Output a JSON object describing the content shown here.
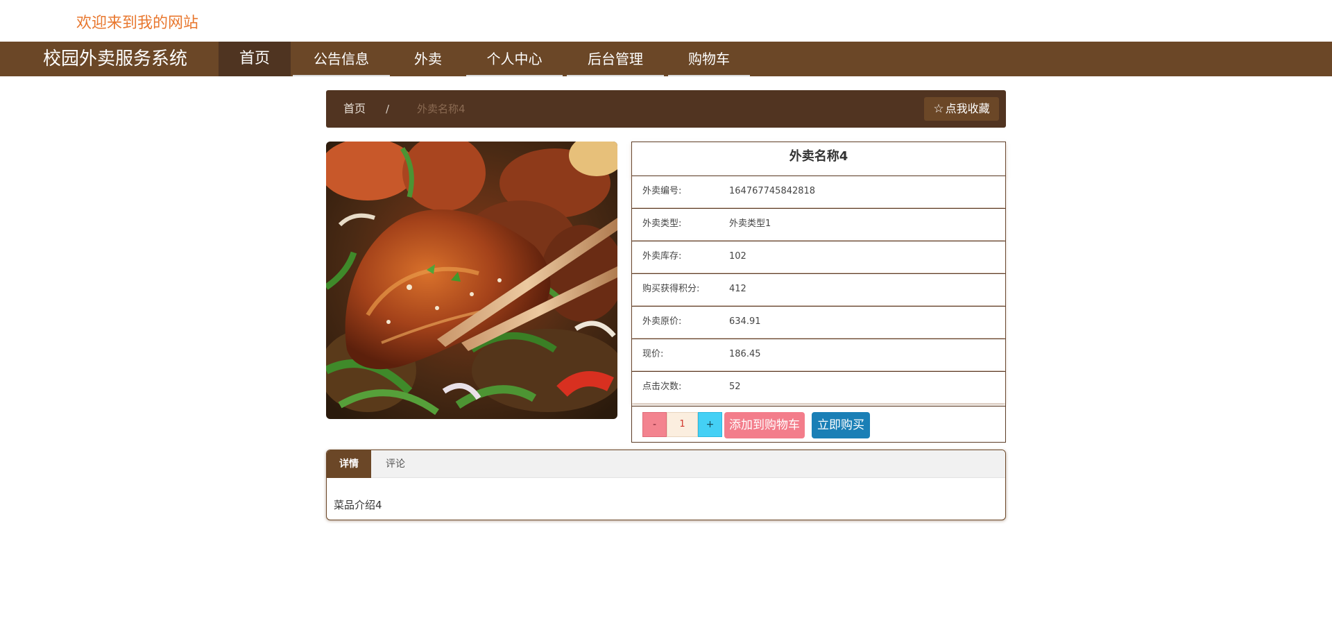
{
  "header": {
    "welcome": "欢迎来到我的网站"
  },
  "navbar": {
    "brand": "校园外卖服务系统",
    "items": [
      {
        "label": "首页",
        "active": true
      },
      {
        "label": "公告信息",
        "active": false
      },
      {
        "label": "外卖",
        "active": false
      },
      {
        "label": "个人中心",
        "active": false
      },
      {
        "label": "后台管理",
        "active": false
      },
      {
        "label": "购物车",
        "active": false
      }
    ]
  },
  "breadcrumb": {
    "home": "首页",
    "separator": "/",
    "current": "外卖名称4",
    "favorite_label": "点我收藏",
    "favorite_icon": "star-outline-icon"
  },
  "product": {
    "title": "外卖名称4",
    "fields": [
      {
        "label": "外卖编号:",
        "value": "1647677458428​18"
      },
      {
        "label": "外卖类型:",
        "value": "外卖类型1"
      },
      {
        "label": "外卖库存:",
        "value": "102"
      },
      {
        "label": "购买获得积分:",
        "value": "412"
      },
      {
        "label": "外卖原价:",
        "value": "634.91"
      },
      {
        "label": "现价:",
        "value": "186.45"
      },
      {
        "label": "点击次数:",
        "value": "52"
      }
    ]
  },
  "actions": {
    "minus": "-",
    "quantity": "1",
    "plus": "+",
    "add_to_cart": "添加到购物车",
    "buy_now": "立即购买"
  },
  "tabs": {
    "items": [
      {
        "label": "详情",
        "active": true
      },
      {
        "label": "评论",
        "active": false
      }
    ],
    "content": "菜品介绍4"
  },
  "colors": {
    "nav_bg": "#6b4727",
    "nav_active": "#4f3421",
    "breadcrumb_bg": "#513421",
    "welcome_text": "#e8772e",
    "cart_button": "#f37d8b",
    "buy_button": "#1a7fb6",
    "plus_button": "#44d0f5",
    "minus_button": "#f3838f"
  }
}
